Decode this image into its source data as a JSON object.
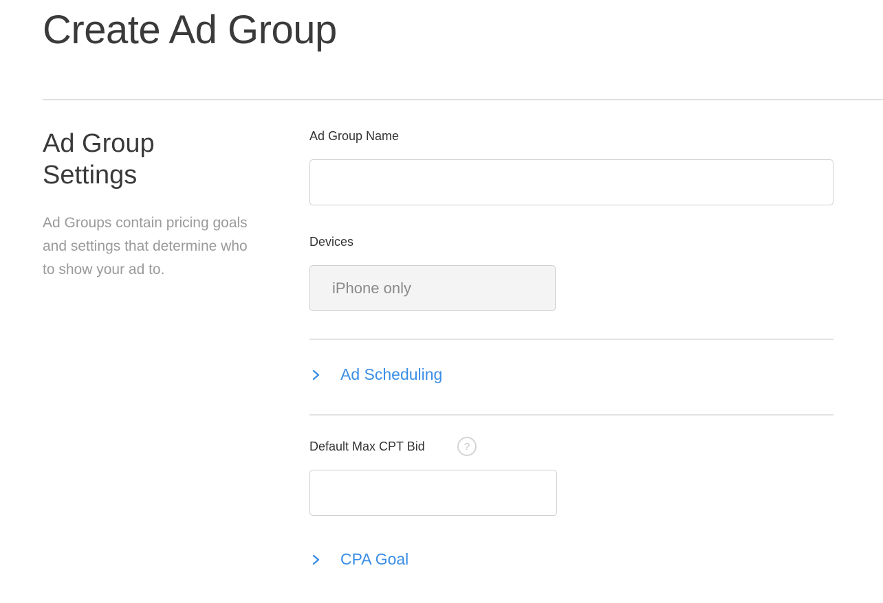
{
  "page": {
    "title": "Create Ad Group"
  },
  "settings_section": {
    "heading": "Ad Group Settings",
    "description": "Ad Groups contain pricing goals and settings that determine who to show your ad to."
  },
  "form": {
    "ad_group_name": {
      "label": "Ad Group Name",
      "value": "",
      "placeholder": ""
    },
    "devices": {
      "label": "Devices",
      "value": "iPhone only"
    },
    "ad_scheduling": {
      "label": "Ad Scheduling",
      "icon": "chevron-right-icon"
    },
    "default_max_cpt_bid": {
      "label": "Default Max CPT Bid",
      "help_icon": "question-mark-icon",
      "help_glyph": "?",
      "value": "",
      "placeholder": ""
    },
    "cpa_goal": {
      "label": "CPA Goal",
      "icon": "chevron-right-icon"
    }
  },
  "colors": {
    "link": "#3a8ee6",
    "muted_text": "#9a9a9a",
    "border": "#cfcfcf"
  }
}
